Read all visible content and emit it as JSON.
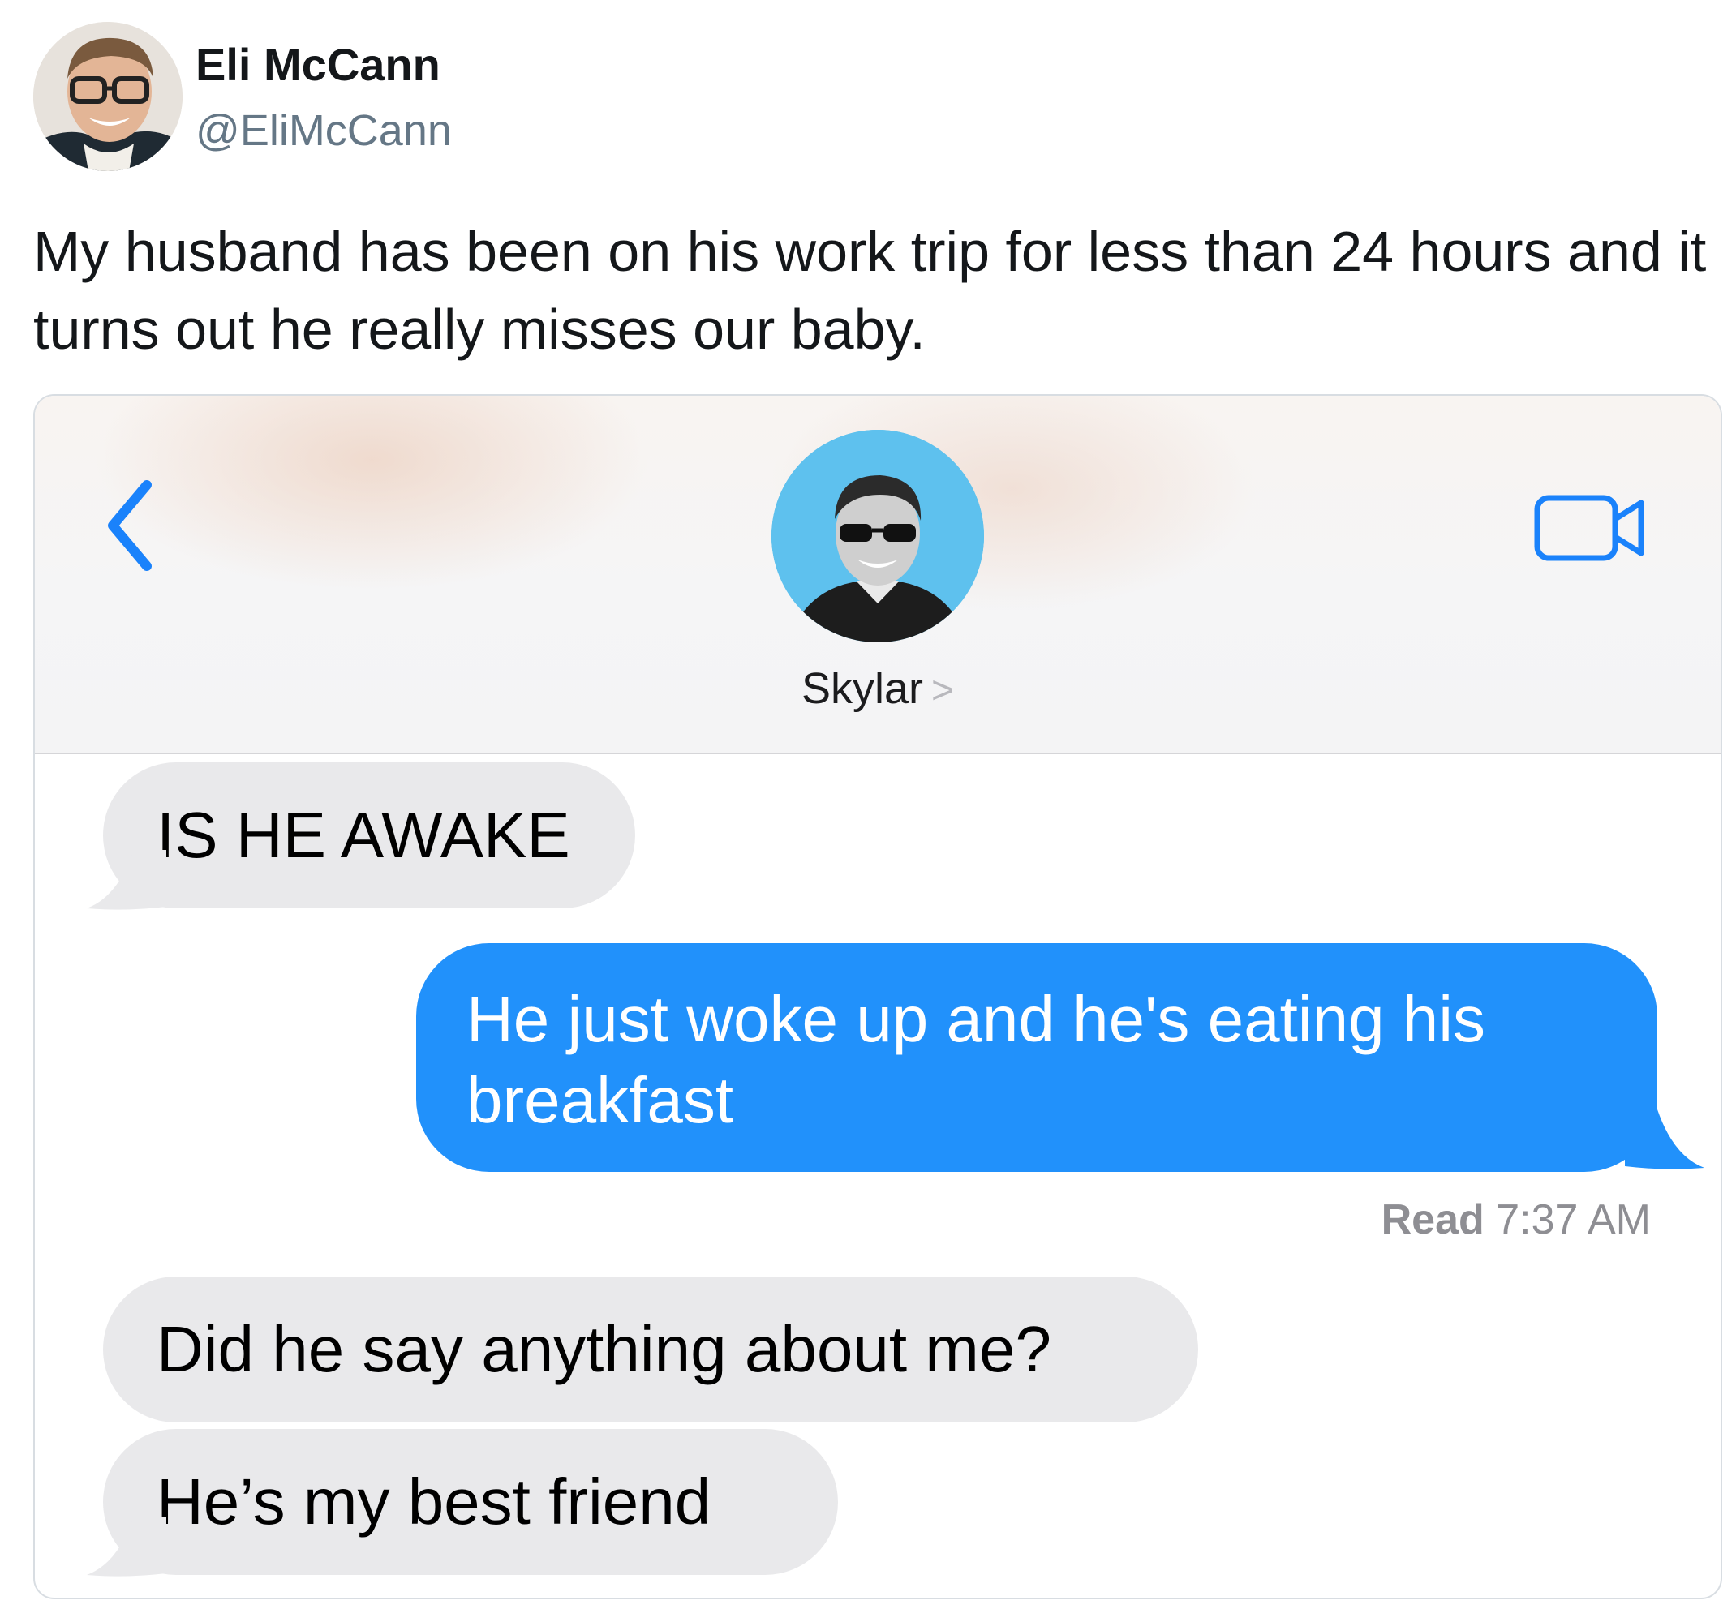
{
  "tweet": {
    "author_name": "Eli McCann",
    "author_handle": "@EliMcCann",
    "text": "My husband has been on his work trip for less than 24 hours and it turns out he really misses our baby."
  },
  "conversation": {
    "contact_name": "Skylar",
    "contact_chevron": ">",
    "read_label": "Read",
    "read_time": "7:37 AM",
    "messages": [
      {
        "direction": "received",
        "text": "IS HE AWAKE"
      },
      {
        "direction": "sent",
        "text": "He just woke up and he's eating his breakfast"
      },
      {
        "direction": "received",
        "text": "Did he say anything about me?"
      },
      {
        "direction": "received",
        "text": "He’s my best friend"
      }
    ]
  },
  "icons": {
    "back": "chevron-left-icon",
    "video": "video-camera-icon"
  },
  "colors": {
    "sent_bubble": "#2191fb",
    "received_bubble": "#e9e9eb",
    "ios_blue": "#1a82fb",
    "handle_gray": "#657786",
    "receipt_gray": "#8e8e93"
  }
}
